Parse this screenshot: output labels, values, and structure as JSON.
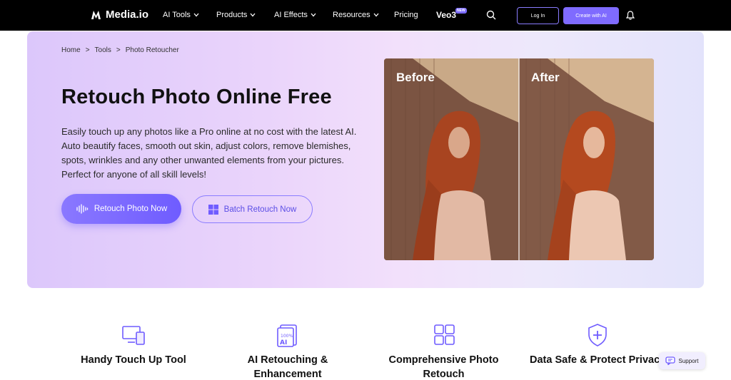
{
  "nav": {
    "logo_text": "Media.io",
    "links": [
      "AI Tools",
      "Products",
      "AI Effects",
      "Resources",
      "Pricing"
    ],
    "veo_label": "Veo3",
    "new_badge": "NEW",
    "login_label": "Log In",
    "create_label": "Create with AI"
  },
  "breadcrumb": [
    "Home",
    ">",
    "Tools",
    ">",
    "Photo Retoucher"
  ],
  "hero": {
    "title": "Retouch Photo Online Free",
    "description": "Easily touch up any photos like a Pro online at no cost with the latest AI. Auto beautify faces, smooth out skin, adjust colors, remove blemishes, spots, wrinkles and any other unwanted elements from your pictures. Perfect for anyone of all skill levels!",
    "primary_button": "Retouch Photo Now",
    "secondary_button": "Batch Retouch Now",
    "before_label": "Before",
    "after_label": "After"
  },
  "features": [
    {
      "title": "Handy Touch Up Tool",
      "sub": "",
      "icon": "monitor-phone-icon"
    },
    {
      "title": "AI Retouching &",
      "sub": "Enhancement",
      "icon": "ai-document-icon"
    },
    {
      "title": "Comprehensive Photo",
      "sub": "Retouch",
      "icon": "grid-icon"
    },
    {
      "title": "Data Safe & Protect Privacy",
      "sub": "",
      "icon": "shield-plus-icon"
    }
  ],
  "support_label": "Support",
  "colors": {
    "accent": "#7f6bff",
    "nav_bg": "#000000"
  }
}
